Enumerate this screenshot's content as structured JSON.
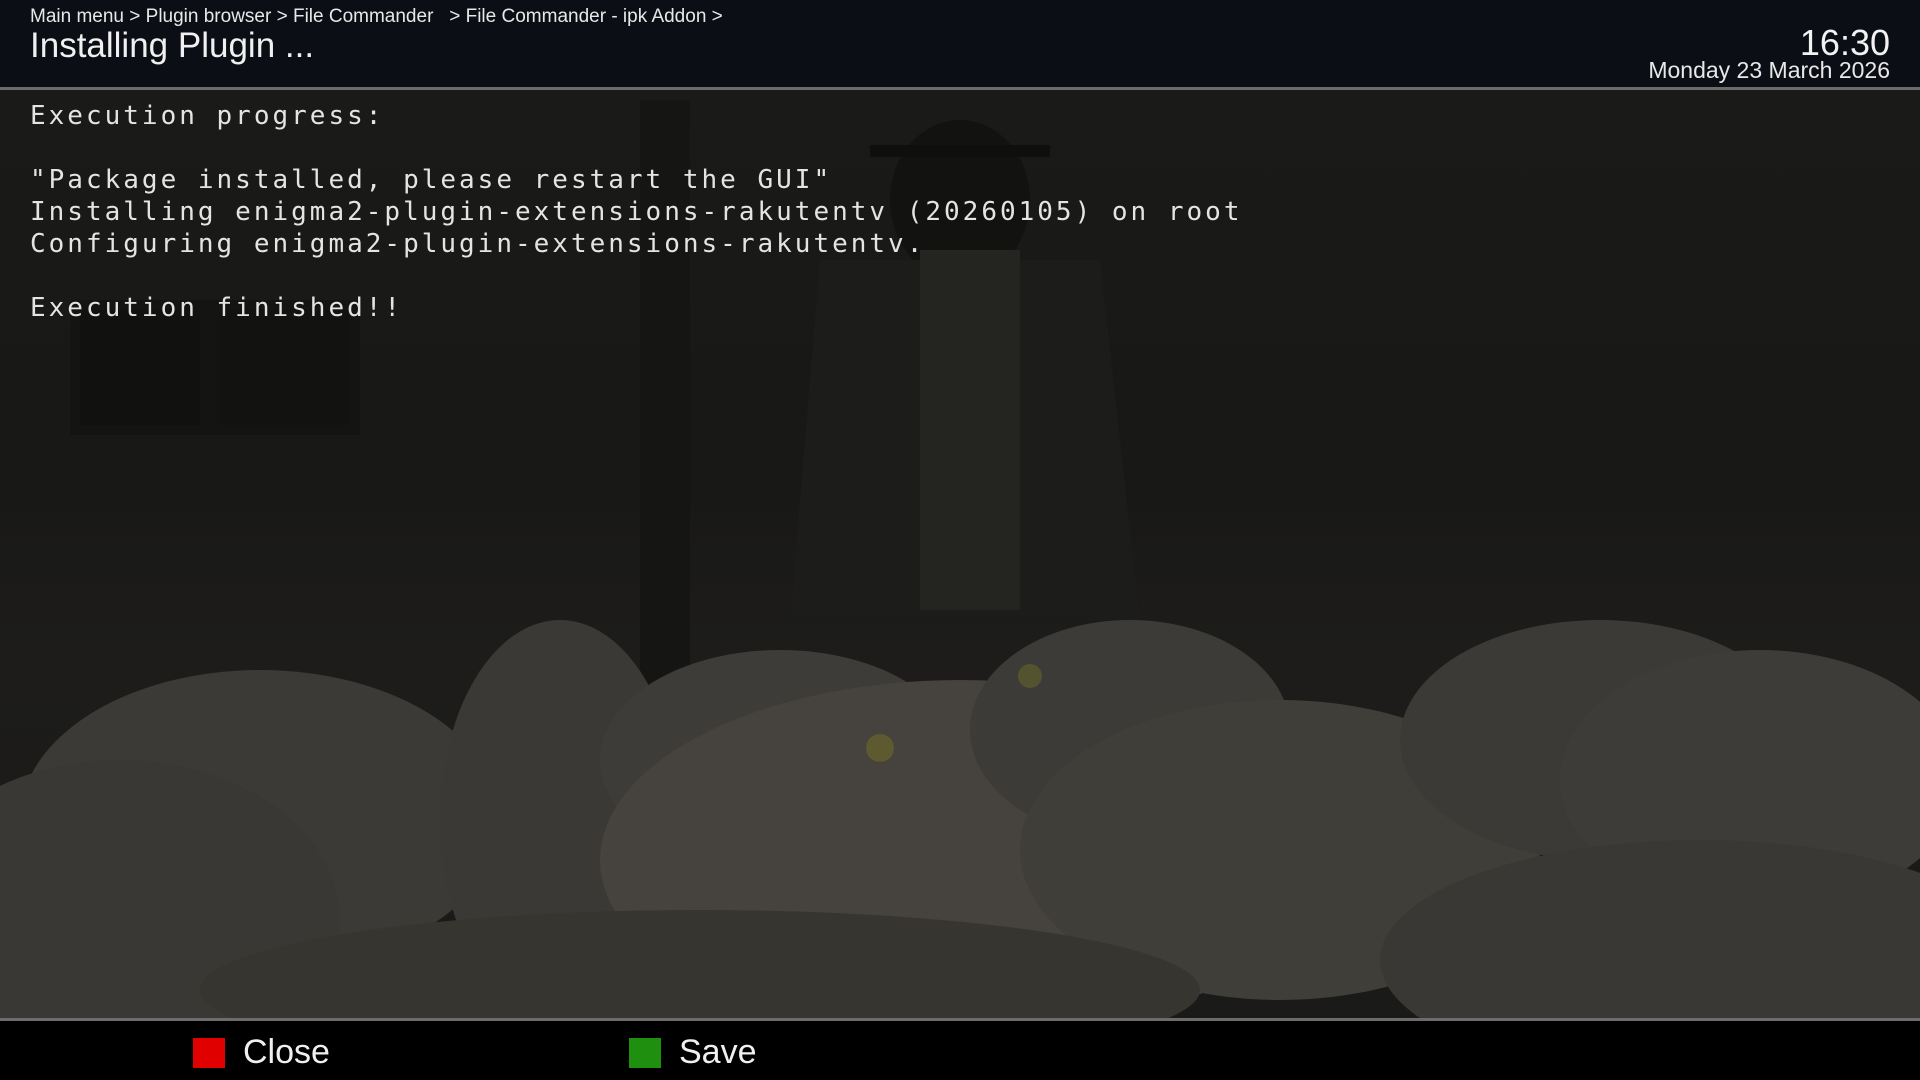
{
  "header": {
    "breadcrumb": "Main menu > Plugin browser > File Commander   > File Commander - ipk Addon >",
    "title": "Installing Plugin ...",
    "time": "16:30",
    "date": "Monday 23 March 2026"
  },
  "console": {
    "lines": [
      "Execution progress:",
      "",
      "\"Package installed, please restart the GUI\"",
      "Installing enigma2-plugin-extensions-rakutentv (20260105) on root",
      "Configuring enigma2-plugin-extensions-rakutentv.",
      "",
      "Execution finished!!"
    ]
  },
  "footer": {
    "buttons": [
      {
        "label": "Close",
        "color": "#e00000",
        "icon": "red-key-icon"
      },
      {
        "label": "Save",
        "color": "#1f8f0f",
        "icon": "green-key-icon"
      }
    ]
  },
  "colors": {
    "header_bg": "#0a0d14",
    "separator": "#6c6c6c",
    "footer_bg": "#000000"
  }
}
